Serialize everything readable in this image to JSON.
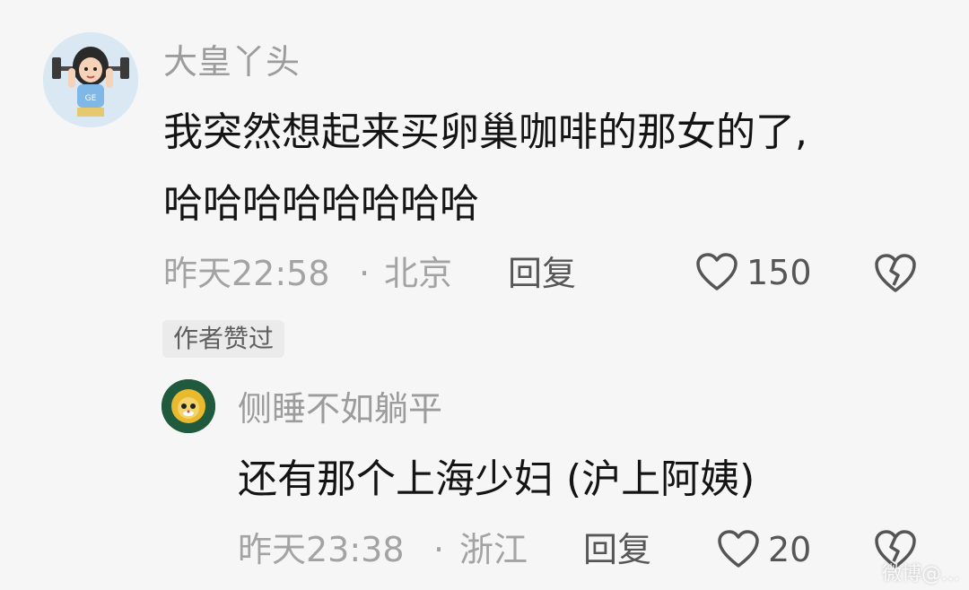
{
  "main_comment": {
    "username": "大皇丫头",
    "text_line1": "我突然想起来买卵巢咖啡的那女的了,",
    "text_line2": "哈哈哈哈哈哈哈哈",
    "timestamp": "昨天22:58",
    "separator": "·",
    "location": "北京",
    "reply_label": "回复",
    "like_count": "150",
    "author_badge": "作者赞过"
  },
  "reply_comment": {
    "username": "侧睡不如躺平",
    "text": "还有那个上海少妇 (沪上阿姨)",
    "timestamp": "昨天23:38",
    "separator": "·",
    "location": "浙江",
    "reply_label": "回复",
    "like_count": "20"
  },
  "watermark": "微博@..."
}
